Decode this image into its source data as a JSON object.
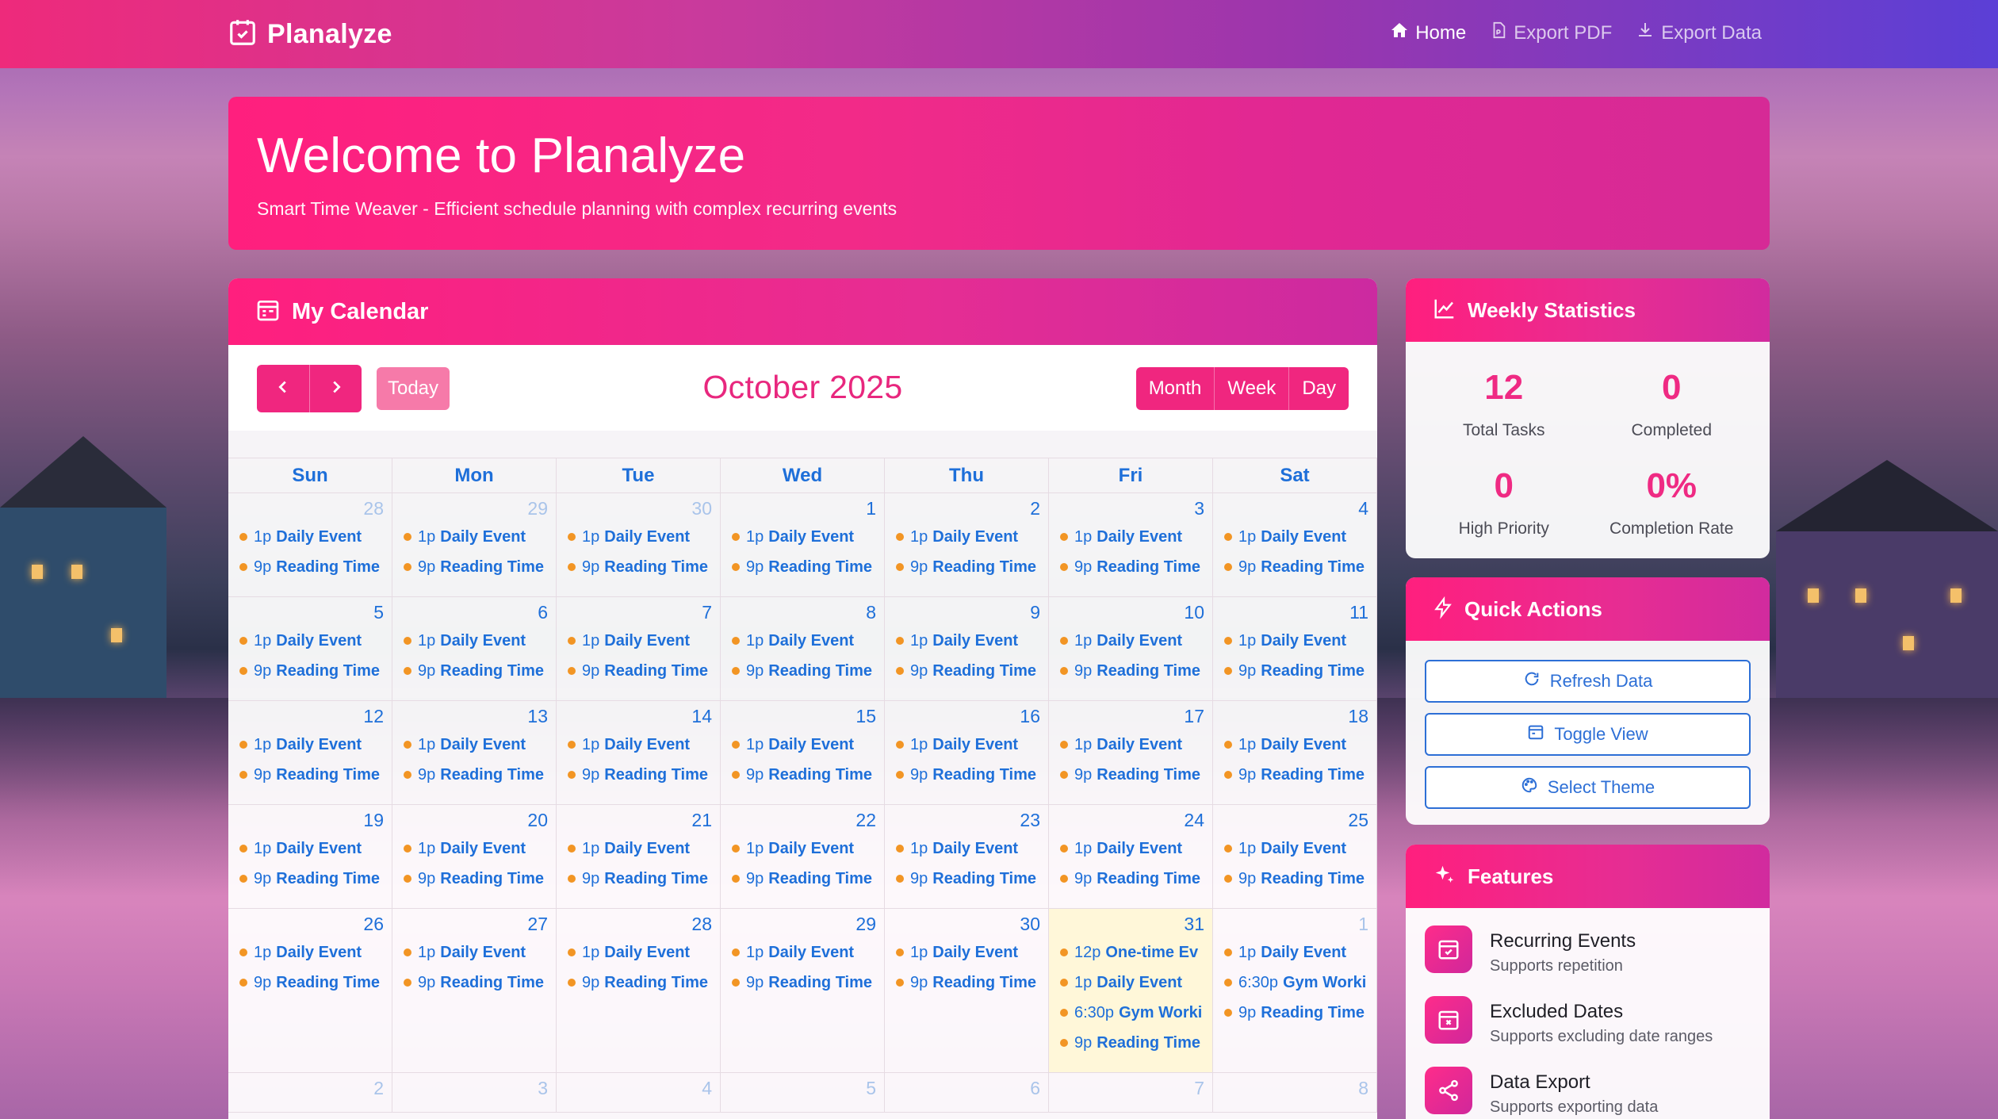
{
  "nav": {
    "brand": "Planalyze",
    "links": [
      {
        "label": "Home",
        "icon": "house-icon",
        "active": true
      },
      {
        "label": "Export PDF",
        "icon": "pdf-file-icon",
        "active": false
      },
      {
        "label": "Export Data",
        "icon": "download-icon",
        "active": false
      }
    ]
  },
  "hero": {
    "title": "Welcome to Planalyze",
    "subtitle": "Smart Time Weaver - Efficient schedule planning with complex recurring events"
  },
  "calendar": {
    "header": "My Calendar",
    "today_label": "Today",
    "title": "October 2025",
    "views": [
      "Month",
      "Week",
      "Day"
    ],
    "weekdays": [
      "Sun",
      "Mon",
      "Tue",
      "Wed",
      "Thu",
      "Fri",
      "Sat"
    ],
    "weeks": [
      [
        {
          "day": "28",
          "other": true,
          "events": [
            [
              "1p",
              "Daily Event"
            ],
            [
              "9p",
              "Reading Time"
            ]
          ]
        },
        {
          "day": "29",
          "other": true,
          "events": [
            [
              "1p",
              "Daily Event"
            ],
            [
              "9p",
              "Reading Time"
            ]
          ]
        },
        {
          "day": "30",
          "other": true,
          "events": [
            [
              "1p",
              "Daily Event"
            ],
            [
              "9p",
              "Reading Time"
            ]
          ]
        },
        {
          "day": "1",
          "events": [
            [
              "1p",
              "Daily Event"
            ],
            [
              "9p",
              "Reading Time"
            ]
          ]
        },
        {
          "day": "2",
          "events": [
            [
              "1p",
              "Daily Event"
            ],
            [
              "9p",
              "Reading Time"
            ]
          ]
        },
        {
          "day": "3",
          "events": [
            [
              "1p",
              "Daily Event"
            ],
            [
              "9p",
              "Reading Time"
            ]
          ]
        },
        {
          "day": "4",
          "events": [
            [
              "1p",
              "Daily Event"
            ],
            [
              "9p",
              "Reading Time"
            ]
          ]
        }
      ],
      [
        {
          "day": "5",
          "events": [
            [
              "1p",
              "Daily Event"
            ],
            [
              "9p",
              "Reading Time"
            ]
          ]
        },
        {
          "day": "6",
          "events": [
            [
              "1p",
              "Daily Event"
            ],
            [
              "9p",
              "Reading Time"
            ]
          ]
        },
        {
          "day": "7",
          "events": [
            [
              "1p",
              "Daily Event"
            ],
            [
              "9p",
              "Reading Time"
            ]
          ]
        },
        {
          "day": "8",
          "events": [
            [
              "1p",
              "Daily Event"
            ],
            [
              "9p",
              "Reading Time"
            ]
          ]
        },
        {
          "day": "9",
          "events": [
            [
              "1p",
              "Daily Event"
            ],
            [
              "9p",
              "Reading Time"
            ]
          ]
        },
        {
          "day": "10",
          "events": [
            [
              "1p",
              "Daily Event"
            ],
            [
              "9p",
              "Reading Time"
            ]
          ]
        },
        {
          "day": "11",
          "events": [
            [
              "1p",
              "Daily Event"
            ],
            [
              "9p",
              "Reading Time"
            ]
          ]
        }
      ],
      [
        {
          "day": "12",
          "events": [
            [
              "1p",
              "Daily Event"
            ],
            [
              "9p",
              "Reading Time"
            ]
          ]
        },
        {
          "day": "13",
          "events": [
            [
              "1p",
              "Daily Event"
            ],
            [
              "9p",
              "Reading Time"
            ]
          ]
        },
        {
          "day": "14",
          "events": [
            [
              "1p",
              "Daily Event"
            ],
            [
              "9p",
              "Reading Time"
            ]
          ]
        },
        {
          "day": "15",
          "events": [
            [
              "1p",
              "Daily Event"
            ],
            [
              "9p",
              "Reading Time"
            ]
          ]
        },
        {
          "day": "16",
          "events": [
            [
              "1p",
              "Daily Event"
            ],
            [
              "9p",
              "Reading Time"
            ]
          ]
        },
        {
          "day": "17",
          "events": [
            [
              "1p",
              "Daily Event"
            ],
            [
              "9p",
              "Reading Time"
            ]
          ]
        },
        {
          "day": "18",
          "events": [
            [
              "1p",
              "Daily Event"
            ],
            [
              "9p",
              "Reading Time"
            ]
          ]
        }
      ],
      [
        {
          "day": "19",
          "events": [
            [
              "1p",
              "Daily Event"
            ],
            [
              "9p",
              "Reading Time"
            ]
          ]
        },
        {
          "day": "20",
          "events": [
            [
              "1p",
              "Daily Event"
            ],
            [
              "9p",
              "Reading Time"
            ]
          ]
        },
        {
          "day": "21",
          "events": [
            [
              "1p",
              "Daily Event"
            ],
            [
              "9p",
              "Reading Time"
            ]
          ]
        },
        {
          "day": "22",
          "events": [
            [
              "1p",
              "Daily Event"
            ],
            [
              "9p",
              "Reading Time"
            ]
          ]
        },
        {
          "day": "23",
          "events": [
            [
              "1p",
              "Daily Event"
            ],
            [
              "9p",
              "Reading Time"
            ]
          ]
        },
        {
          "day": "24",
          "events": [
            [
              "1p",
              "Daily Event"
            ],
            [
              "9p",
              "Reading Time"
            ]
          ]
        },
        {
          "day": "25",
          "events": [
            [
              "1p",
              "Daily Event"
            ],
            [
              "9p",
              "Reading Time"
            ]
          ]
        }
      ],
      [
        {
          "day": "26",
          "events": [
            [
              "1p",
              "Daily Event"
            ],
            [
              "9p",
              "Reading Time"
            ]
          ]
        },
        {
          "day": "27",
          "events": [
            [
              "1p",
              "Daily Event"
            ],
            [
              "9p",
              "Reading Time"
            ]
          ]
        },
        {
          "day": "28",
          "events": [
            [
              "1p",
              "Daily Event"
            ],
            [
              "9p",
              "Reading Time"
            ]
          ]
        },
        {
          "day": "29",
          "events": [
            [
              "1p",
              "Daily Event"
            ],
            [
              "9p",
              "Reading Time"
            ]
          ]
        },
        {
          "day": "30",
          "events": [
            [
              "1p",
              "Daily Event"
            ],
            [
              "9p",
              "Reading Time"
            ]
          ]
        },
        {
          "day": "31",
          "today": true,
          "events": [
            [
              "12p",
              "One-time Ev"
            ],
            [
              "1p",
              "Daily Event"
            ],
            [
              "6:30p",
              "Gym Worki"
            ],
            [
              "9p",
              "Reading Time"
            ]
          ]
        },
        {
          "day": "1",
          "other": true,
          "events": [
            [
              "1p",
              "Daily Event"
            ],
            [
              "6:30p",
              "Gym Worki"
            ],
            [
              "9p",
              "Reading Time"
            ]
          ]
        }
      ],
      [
        {
          "day": "2",
          "other": true,
          "events": []
        },
        {
          "day": "3",
          "other": true,
          "events": []
        },
        {
          "day": "4",
          "other": true,
          "events": []
        },
        {
          "day": "5",
          "other": true,
          "events": []
        },
        {
          "day": "6",
          "other": true,
          "events": []
        },
        {
          "day": "7",
          "other": true,
          "events": []
        },
        {
          "day": "8",
          "other": true,
          "events": []
        }
      ]
    ]
  },
  "stats": {
    "header": "Weekly Statistics",
    "items": [
      {
        "value": "12",
        "label": "Total Tasks"
      },
      {
        "value": "0",
        "label": "Completed"
      },
      {
        "value": "0",
        "label": "High Priority"
      },
      {
        "value": "0%",
        "label": "Completion Rate"
      }
    ]
  },
  "quick_actions": {
    "header": "Quick Actions",
    "buttons": [
      {
        "label": "Refresh Data",
        "icon": "refresh-icon"
      },
      {
        "label": "Toggle View",
        "icon": "calendar-view-icon"
      },
      {
        "label": "Select Theme",
        "icon": "palette-icon"
      }
    ]
  },
  "features": {
    "header": "Features",
    "items": [
      {
        "title": "Recurring Events",
        "desc": "Supports repetition",
        "icon": "calendar-check-icon"
      },
      {
        "title": "Excluded Dates",
        "desc": "Supports excluding date ranges",
        "icon": "calendar-x-icon"
      },
      {
        "title": "Data Export",
        "desc": "Supports exporting data",
        "icon": "share-icon"
      }
    ]
  },
  "colors": {
    "accent": "#F0267F",
    "link_blue": "#1E6FD9",
    "event_dot": "#F29524",
    "today_bg": "#FFF7D2"
  }
}
